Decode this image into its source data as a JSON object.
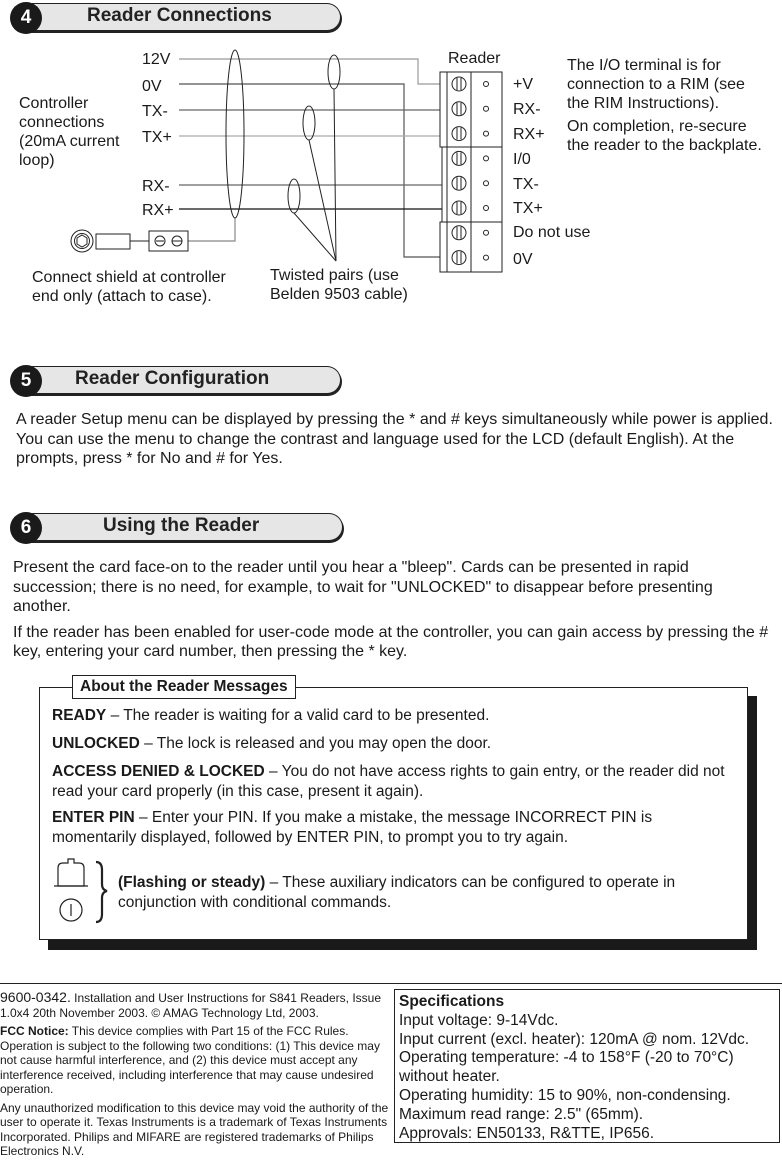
{
  "sections": {
    "connections": {
      "number": "4",
      "title": "Reader Connections"
    },
    "configuration": {
      "number": "5",
      "title": "Reader Configuration"
    },
    "using": {
      "number": "6",
      "title": "Using the Reader"
    }
  },
  "diagram": {
    "controller_label": [
      "Controller",
      "connections",
      "(20mA current",
      "loop)"
    ],
    "controller_wires": [
      "12V",
      "0V",
      "TX-",
      "TX+",
      "RX-",
      "RX+"
    ],
    "reader_label": "Reader",
    "reader_terminals": [
      "+V",
      "RX-",
      "RX+",
      "I/0",
      "TX-",
      "TX+",
      "Do not use",
      "0V"
    ],
    "io_note": [
      "The I/O terminal is for",
      "connection to a RIM (see",
      "the RIM Instructions)."
    ],
    "resecure_note": [
      "On completion, re-secure",
      "the reader to the backplate."
    ],
    "shield_note": [
      "Connect shield at controller",
      "end only (attach to case)."
    ],
    "twisted_note": [
      "Twisted pairs (use",
      "Belden 9503 cable)"
    ]
  },
  "configuration_text": "A reader Setup menu can be displayed by pressing the * and # keys simultaneously while power is applied. You can use the menu to change the contrast and language used for the LCD (default English). At the prompts, press * for No and # for Yes.",
  "using_text": [
    "Present the card face-on to the reader until you hear a \"bleep\". Cards can be presented in rapid succession; there is no need, for example,  to wait for \"UNLOCKED\" to disappear before presenting another.",
    "If the reader has been enabled for user-code mode at the controller, you can gain access by pressing the # key, entering your card number, then pressing the * key."
  ],
  "messages_box": {
    "title": "About the Reader Messages",
    "items": [
      {
        "term": "READY",
        "desc": " – The reader is waiting for a valid card to be presented."
      },
      {
        "term": "UNLOCKED",
        "desc": " – The lock is released and you may open the door."
      },
      {
        "term": "ACCESS DENIED & LOCKED",
        "desc": " – You do not have access rights to gain entry, or the reader did not read your card properly (in this case, present it again)."
      },
      {
        "term": "ENTER PIN",
        "desc": " – Enter your PIN. If you make a mistake, the message INCORRECT PIN is momentarily displayed, followed by ENTER PIN, to prompt you to try again."
      }
    ],
    "indicator": {
      "term": "(Flashing or steady)",
      "desc": " – These auxiliary indicators can be configured to operate in conjunction with conditional commands."
    }
  },
  "footer": {
    "doc_number": "9600-0342.",
    "doc_info": " Installation and User Instructions for S841 Readers, Issue 1.0x4 20th November 2003. © AMAG Technology Ltd, 2003.",
    "fcc_label": "FCC Notice:",
    "fcc_text": " This device complies with Part 15 of the FCC Rules. Operation is subject to the following two conditions: (1) This device may not cause harmful interference, and (2) this device must accept any interference received, including interference that may cause undesired operation.",
    "trademark_text": "Any unauthorized modification to this device may void the authority of the user to operate it. Texas Instruments is a trademark of Texas Instruments Incorporated. Philips and MIFARE are registered trademarks of Philips Electronics N.V."
  },
  "specifications": {
    "title": "Specifications",
    "lines": [
      "Input voltage: 9-14Vdc.",
      "Input current (excl. heater): 120mA @ nom. 12Vdc.",
      "Operating temperature: -4 to 158°F (-20 to 70°C)",
      "without heater.",
      "Operating humidity: 15 to 90%, non-condensing.",
      "Maximum read range: 2.5\" (65mm).",
      "Approvals: EN50133, R&TTE, IP656."
    ]
  }
}
